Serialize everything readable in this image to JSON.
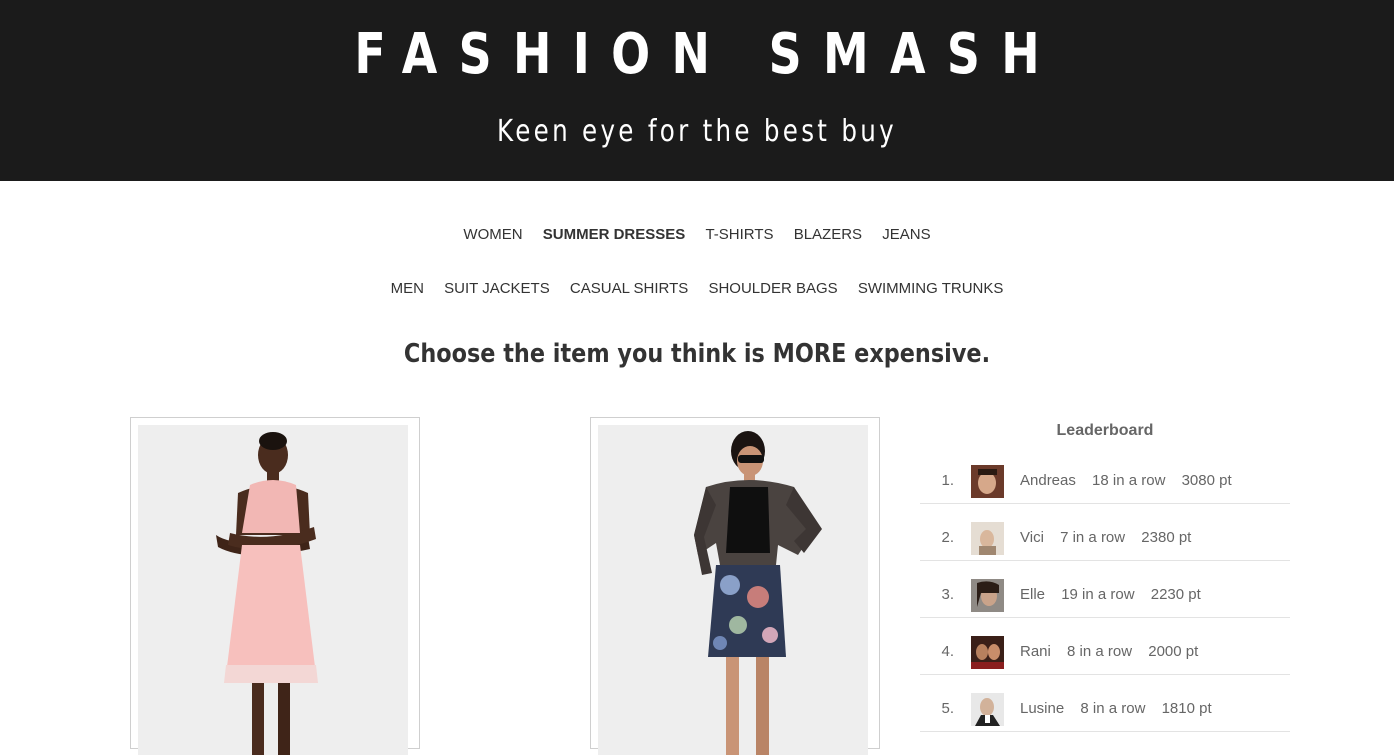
{
  "header": {
    "title": "FASHION SMASH",
    "tagline": "Keen eye for the best buy"
  },
  "nav": {
    "women": [
      {
        "label": "WOMEN",
        "active": false
      },
      {
        "label": "SUMMER DRESSES",
        "active": true
      },
      {
        "label": "T-SHIRTS",
        "active": false
      },
      {
        "label": "BLAZERS",
        "active": false
      },
      {
        "label": "JEANS",
        "active": false
      }
    ],
    "men": [
      {
        "label": "MEN",
        "active": false
      },
      {
        "label": "SUIT JACKETS",
        "active": false
      },
      {
        "label": "CASUAL SHIRTS",
        "active": false
      },
      {
        "label": "SHOULDER BAGS",
        "active": false
      },
      {
        "label": "SWIMMING TRUNKS",
        "active": false
      }
    ]
  },
  "prompt": "Choose the item you think is MORE expensive.",
  "products": [
    {
      "name": "pink-pleated-summer-dress"
    },
    {
      "name": "floral-pencil-skirt-leather-jacket"
    }
  ],
  "leaderboard": {
    "title": "Leaderboard",
    "entries": [
      {
        "rank": "1.",
        "name": "Andreas",
        "streak": "18 in a row",
        "points": "3080 pt"
      },
      {
        "rank": "2.",
        "name": "Vici",
        "streak": "7 in a row",
        "points": "2380 pt"
      },
      {
        "rank": "3.",
        "name": "Elle",
        "streak": "19 in a row",
        "points": "2230 pt"
      },
      {
        "rank": "4.",
        "name": "Rani",
        "streak": "8 in a row",
        "points": "2000 pt"
      },
      {
        "rank": "5.",
        "name": "Lusine",
        "streak": "8 in a row",
        "points": "1810 pt"
      }
    ]
  },
  "colors": {
    "header_bg": "#1b1b1b",
    "header_text": "#ffffff",
    "text": "#333333",
    "muted": "#666666",
    "divider": "#e3e3e3"
  }
}
